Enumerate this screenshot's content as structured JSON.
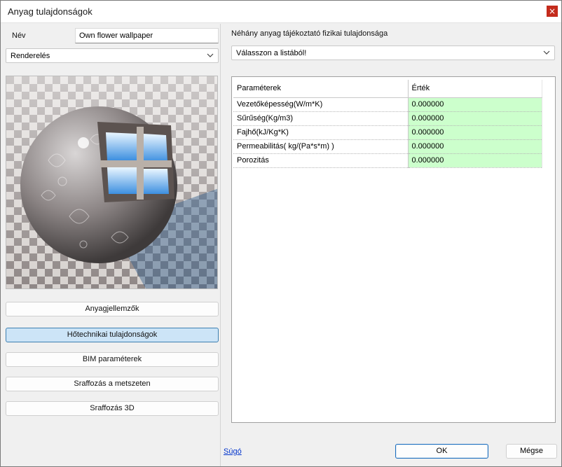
{
  "window": {
    "title": "Anyag tulajdonságok",
    "close_glyph": "×"
  },
  "left": {
    "name_label": "Név",
    "name_value": "Own flower wallpaper",
    "mode_select": "Renderelés",
    "preview_icon": "material-sphere-preview",
    "buttons": {
      "material_attributes": "Anyagjellemzők",
      "thermal_properties": "Hőtechnikai tulajdonságok",
      "bim_parameters": "BIM paraméterek",
      "hatch_section": "Sraffozás a metszeten",
      "hatch_3d": "Sraffozás 3D"
    }
  },
  "right": {
    "heading": "Néhány anyag tájékoztató fizikai tulajdonsága",
    "preset_select": "Válasszon a listából!",
    "table": {
      "headers": [
        "Paraméterek",
        "Érték"
      ],
      "rows": [
        {
          "param": "Vezetőképesség(W/m*K)",
          "value": "0.000000"
        },
        {
          "param": "Sűrűség(Kg/m3)",
          "value": "0.000000"
        },
        {
          "param": "Fajhő(kJ/Kg*K)",
          "value": "0.000000"
        },
        {
          "param": "Permeabilitás( kg/(Pa*s*m) )",
          "value": "0.000000"
        },
        {
          "param": "Porozitás",
          "value": "0.000000"
        }
      ]
    }
  },
  "footer": {
    "help_link": "Súgó",
    "ok_label": "OK",
    "cancel_label": "Mégse"
  },
  "colors": {
    "value_cell_bg": "#ccffcc",
    "active_button_bg": "#cce4f7",
    "close_button_bg": "#c42b1c",
    "link": "#0033cc"
  }
}
